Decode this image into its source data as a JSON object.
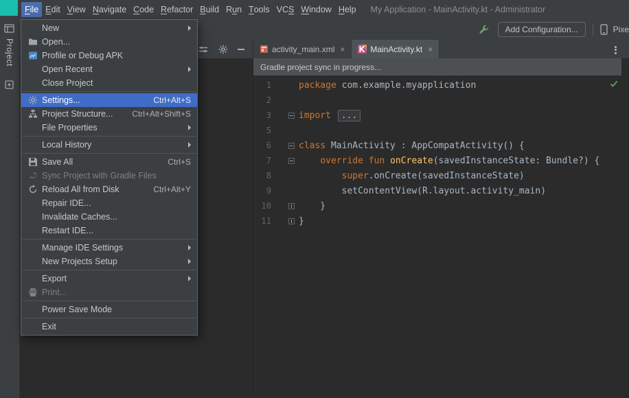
{
  "colors": {
    "selection": "#3f6cc7",
    "menubar_open": "#4b6eaf",
    "keyword": "#cc7832",
    "fn": "#ffc66b",
    "code": "#a9b7c6",
    "editor_bg": "#2b2b2b",
    "panel_bg": "#3c3f41",
    "banner_bg": "#4c5053",
    "check": "#5c9a57",
    "teal": "#1abfae",
    "wrench": "#67a568",
    "linenum": "#606366"
  },
  "window": {
    "title": "My Application - MainActivity.kt - Administrator"
  },
  "menubar": [
    {
      "pre": "",
      "key": "F",
      "post": "ile",
      "open": true
    },
    {
      "pre": "",
      "key": "E",
      "post": "dit"
    },
    {
      "pre": "",
      "key": "V",
      "post": "iew"
    },
    {
      "pre": "",
      "key": "N",
      "post": "avigate"
    },
    {
      "pre": "",
      "key": "C",
      "post": "ode"
    },
    {
      "pre": "",
      "key": "R",
      "post": "efactor"
    },
    {
      "pre": "",
      "key": "B",
      "post": "uild"
    },
    {
      "pre": "R",
      "key": "u",
      "post": "n"
    },
    {
      "pre": "",
      "key": "T",
      "post": "ools"
    },
    {
      "pre": "VC",
      "key": "S",
      "post": ""
    },
    {
      "pre": "",
      "key": "W",
      "post": "indow"
    },
    {
      "pre": "",
      "key": "H",
      "post": "elp"
    }
  ],
  "toolbar": {
    "add_configuration": "Add Configuration...",
    "device_partial": "Pixe"
  },
  "project_panel": {
    "label": "Project"
  },
  "file_menu": [
    {
      "label": "New",
      "submenu": true
    },
    {
      "label": "Open...",
      "icon": "folder"
    },
    {
      "label": "Profile or Debug APK",
      "icon": "profile"
    },
    {
      "label": "Open Recent",
      "submenu": true
    },
    {
      "label": "Close Project",
      "sep_after": true
    },
    {
      "label": "Settings...",
      "icon": "gear",
      "shortcut": "Ctrl+Alt+S",
      "selected": true
    },
    {
      "label": "Project Structure...",
      "icon": "structure",
      "shortcut": "Ctrl+Alt+Shift+S"
    },
    {
      "label": "File Properties",
      "submenu": true,
      "sep_after": true
    },
    {
      "label": "Local History",
      "submenu": true,
      "sep_after": true
    },
    {
      "label": "Save All",
      "icon": "save",
      "shortcut": "Ctrl+S"
    },
    {
      "label": "Sync Project with Gradle Files",
      "icon": "gradle",
      "disabled": true
    },
    {
      "label": "Reload All from Disk",
      "icon": "reload",
      "shortcut": "Ctrl+Alt+Y"
    },
    {
      "label": "Repair IDE..."
    },
    {
      "label": "Invalidate Caches..."
    },
    {
      "label": "Restart IDE...",
      "sep_after": true
    },
    {
      "label": "Manage IDE Settings",
      "submenu": true
    },
    {
      "label": "New Projects Setup",
      "submenu": true,
      "sep_after": true
    },
    {
      "label": "Export",
      "submenu": true
    },
    {
      "label": "Print...",
      "icon": "print",
      "disabled": true,
      "sep_after": true
    },
    {
      "label": "Power Save Mode",
      "sep_after": true
    },
    {
      "label": "Exit"
    }
  ],
  "tabs": [
    {
      "label": "activity_main.xml",
      "icon": "layout",
      "active": false
    },
    {
      "label": "MainActivity.kt",
      "icon": "kotlin",
      "active": true
    }
  ],
  "notification": "Gradle project sync in progress...",
  "editor": {
    "lines": [
      {
        "num": "1",
        "tokens": [
          {
            "t": "package ",
            "c": "kw"
          },
          {
            "t": "com.example.myapplication",
            "c": "pl"
          }
        ]
      },
      {
        "num": "2",
        "tokens": []
      },
      {
        "num": "3",
        "fold": "start",
        "tokens": [
          {
            "t": "import ",
            "c": "kw"
          },
          {
            "t": "...",
            "c": "fold"
          }
        ]
      },
      {
        "num": "5",
        "tokens": []
      },
      {
        "num": "6",
        "fold": "start",
        "tokens": [
          {
            "t": "class ",
            "c": "kw"
          },
          {
            "t": "MainActivity : AppCompatActivity() {",
            "c": "pl"
          }
        ]
      },
      {
        "num": "7",
        "fold": "start",
        "tokens": [
          {
            "t": "    ",
            "c": "pl"
          },
          {
            "t": "override fun ",
            "c": "kw"
          },
          {
            "t": "onCreate",
            "c": "fn"
          },
          {
            "t": "(savedInstanceState: Bundle?) {",
            "c": "pl"
          }
        ]
      },
      {
        "num": "8",
        "tokens": [
          {
            "t": "        ",
            "c": "pl"
          },
          {
            "t": "super",
            "c": "kw"
          },
          {
            "t": ".onCreate(savedInstanceState)",
            "c": "pl"
          }
        ]
      },
      {
        "num": "9",
        "tokens": [
          {
            "t": "        setContentView(R.layout.activity_main)",
            "c": "pl"
          }
        ]
      },
      {
        "num": "10",
        "fold": "end",
        "tokens": [
          {
            "t": "    }",
            "c": "pl"
          }
        ]
      },
      {
        "num": "11",
        "fold": "end",
        "tokens": [
          {
            "t": "}",
            "c": "pl"
          }
        ]
      }
    ]
  }
}
